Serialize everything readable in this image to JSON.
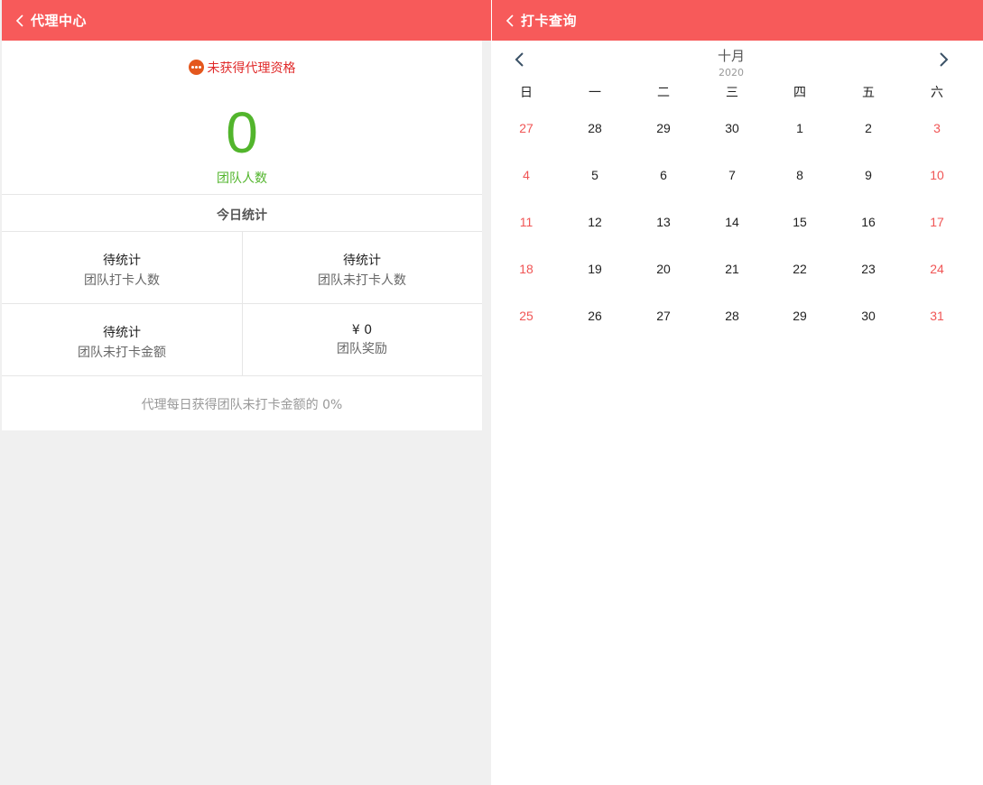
{
  "agent": {
    "title": "代理中心",
    "status_text": "未获得代理资格",
    "team_count": "0",
    "team_label": "团队人数",
    "today_title": "今日统计",
    "stats": [
      {
        "value": "待统计",
        "label": "团队打卡人数"
      },
      {
        "value": "待统计",
        "label": "团队未打卡人数"
      },
      {
        "value": "待统计",
        "label": "团队未打卡金额"
      },
      {
        "value": "¥ 0",
        "label": "团队奖励"
      }
    ],
    "note": "代理每日获得团队未打卡金额的 0%"
  },
  "checkin": {
    "title": "打卡查询",
    "month": "十月",
    "year": "2020",
    "weekdays": [
      "日",
      "一",
      "二",
      "三",
      "四",
      "五",
      "六"
    ],
    "weeks": [
      [
        "27",
        "28",
        "29",
        "30",
        "1",
        "2",
        "3"
      ],
      [
        "4",
        "5",
        "6",
        "7",
        "8",
        "9",
        "10"
      ],
      [
        "11",
        "12",
        "13",
        "14",
        "15",
        "16",
        "17"
      ],
      [
        "18",
        "19",
        "20",
        "21",
        "22",
        "23",
        "24"
      ],
      [
        "25",
        "26",
        "27",
        "28",
        "29",
        "30",
        "31"
      ]
    ]
  },
  "colors": {
    "header": "#f75a5a",
    "accent_green": "#52b52c",
    "status_red": "#e02a2a",
    "weekend": "#f05555"
  },
  "icons": {
    "back": "chevron-left-icon",
    "status": "more-dots-icon",
    "prev_month": "chevron-left-icon",
    "next_month": "chevron-right-icon"
  }
}
